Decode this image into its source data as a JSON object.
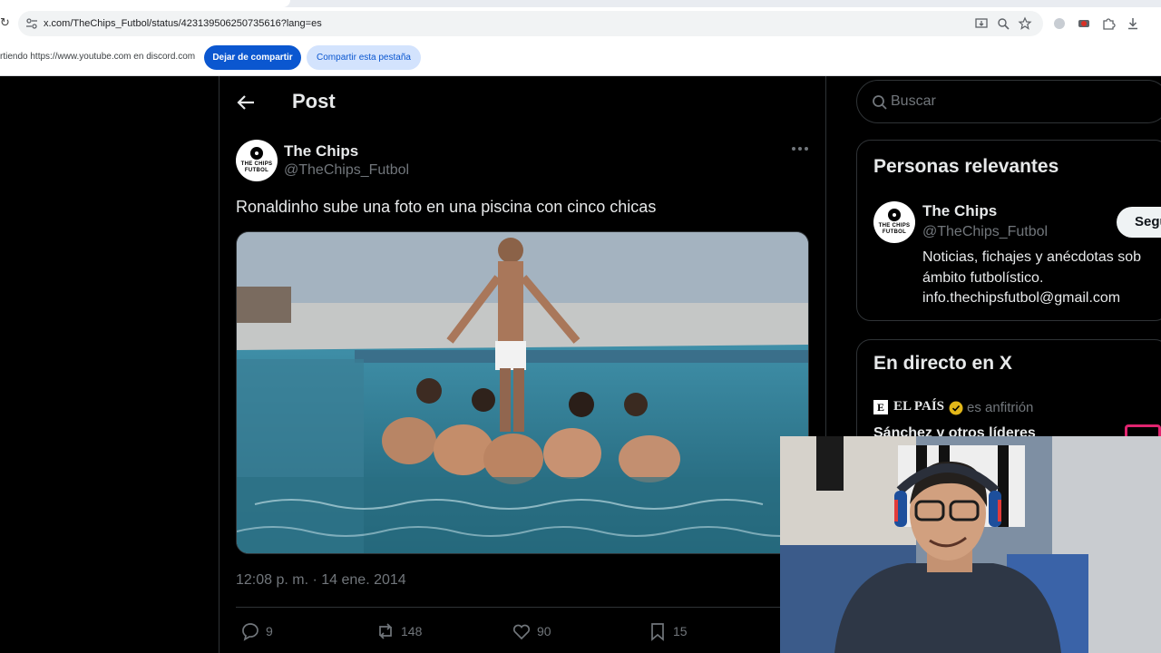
{
  "browser": {
    "url": "x.com/TheChips_Futbol/status/423139506250735616?lang=es",
    "share_text": "rtiendo https://www.youtube.com en discord.com",
    "stop_sharing_label": "Dejar de compartir",
    "share_tab_label": "Compartir esta pestaña",
    "icons": [
      "reload-icon",
      "site-settings-icon",
      "install-icon",
      "zoom-icon",
      "bookmark-star-icon",
      "extension-icon",
      "record-icon",
      "puzzle-icon",
      "download-icon"
    ]
  },
  "post": {
    "header_title": "Post",
    "author_name": "The Chips",
    "author_handle": "@TheChips_Futbol",
    "avatar_text": "THE CHIPS FUTBOL",
    "text": "Ronaldinho sube una foto en una piscina con cinco chicas",
    "timestamp": "12:08 p. m. · 14 ene. 2014",
    "stats": {
      "replies": "9",
      "reposts": "148",
      "likes": "90",
      "bookmarks": "15"
    }
  },
  "sidebar": {
    "search_placeholder": "Buscar",
    "relevant": {
      "title": "Personas relevantes",
      "name": "The Chips",
      "handle": "@TheChips_Futbol",
      "bio": "Noticias, fichajes y anécdotas sob ámbito futbolístico. info.thechipsfutbol@gmail.com",
      "follow_label": "Segu"
    },
    "live": {
      "title": "En directo en X",
      "host_logo": "E",
      "host_name": "EL PAÍS",
      "host_role": "es anfitrión",
      "headline": "Sánchez y otros líderes"
    }
  },
  "colors": {
    "background": "#000000",
    "text": "#e7e9ea",
    "muted": "#71767b",
    "border": "#2f3336",
    "share_button": "#0b57d0",
    "verified_gold": "#e2b719"
  }
}
